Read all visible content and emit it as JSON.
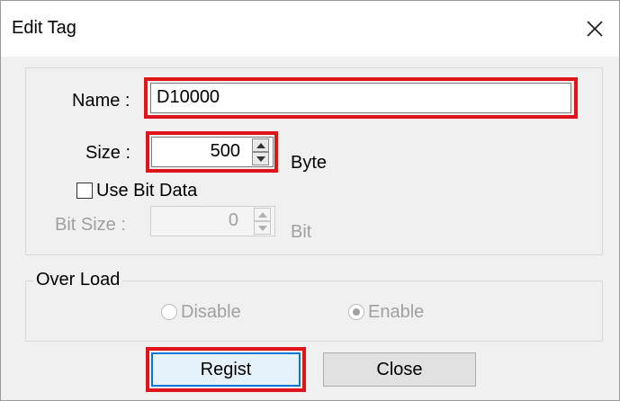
{
  "dialog": {
    "title": "Edit Tag",
    "close_icon": "close-icon"
  },
  "tag": {
    "name_label": "Name :",
    "name_value": "D10000",
    "size_label": "Size :",
    "size_value": "500",
    "size_unit": "Byte",
    "use_bit_label": "Use Bit Data",
    "use_bit_checked": false,
    "bit_size_label": "Bit Size :",
    "bit_size_value": "0",
    "bit_unit": "Bit"
  },
  "over_load": {
    "legend": "Over Load",
    "disable_label": "Disable",
    "enable_label": "Enable",
    "selected": "Enable"
  },
  "buttons": {
    "regist": "Regist",
    "close": "Close"
  },
  "colors": {
    "highlight": "#e0141b",
    "focus": "#0078d7",
    "disabled_text": "#a0a0a0"
  }
}
